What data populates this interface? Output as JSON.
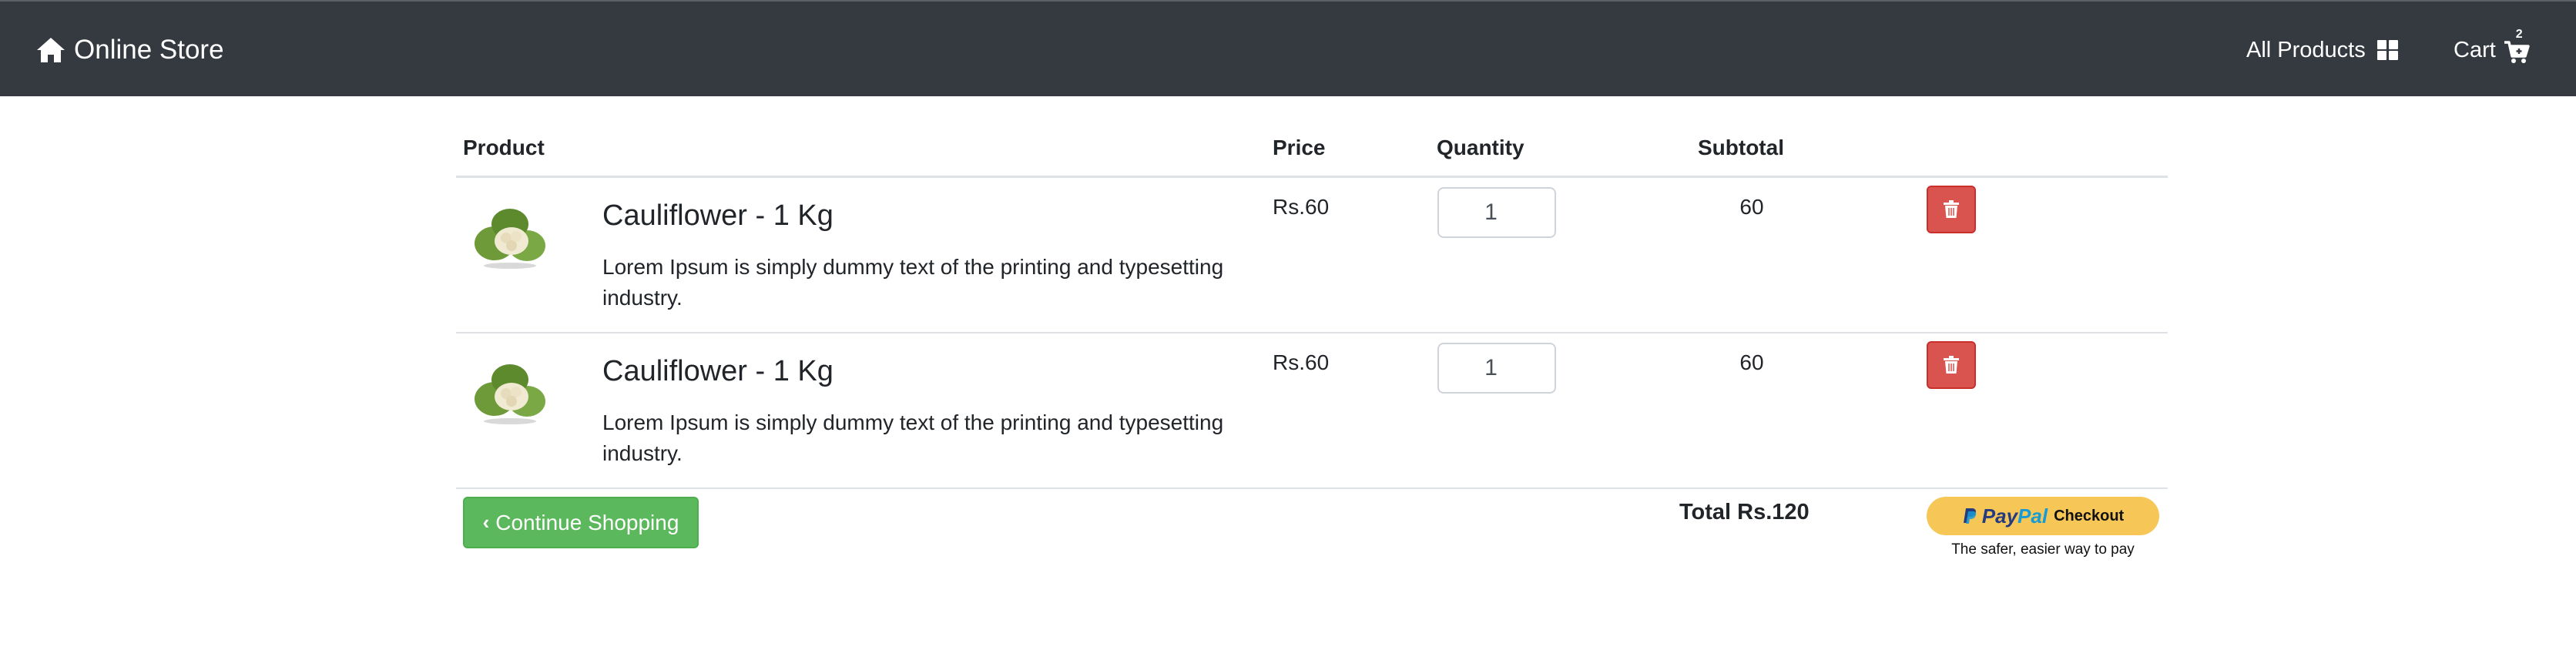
{
  "navbar": {
    "brand": "Online Store",
    "all_products": "All Products",
    "cart": "Cart",
    "cart_count": "2",
    "bg_color": "#343a40"
  },
  "table": {
    "headers": {
      "product": "Product",
      "price": "Price",
      "quantity": "Quantity",
      "subtotal": "Subtotal"
    },
    "rows": [
      {
        "name": "Cauliflower - 1 Kg",
        "description": "Lorem Ipsum is simply dummy text of the printing and typesetting industry.",
        "price": "Rs.60",
        "quantity": "1",
        "subtotal": "60",
        "image": "cauliflower-image"
      },
      {
        "name": "Cauliflower - 1 Kg",
        "description": "Lorem Ipsum is simply dummy text of the printing and typesetting industry.",
        "price": "Rs.60",
        "quantity": "1",
        "subtotal": "60",
        "image": "cauliflower-image"
      }
    ]
  },
  "footer": {
    "continue_label": "Continue Shopping",
    "total": "Total Rs.120",
    "paypal_pay": "Pay",
    "paypal_pal": "Pal",
    "paypal_checkout": "Checkout",
    "paypal_tagline": "The safer, easier way to pay"
  },
  "colors": {
    "danger": "#d9534f",
    "success": "#5cb85c",
    "paypal_yellow": "#f6c757"
  }
}
